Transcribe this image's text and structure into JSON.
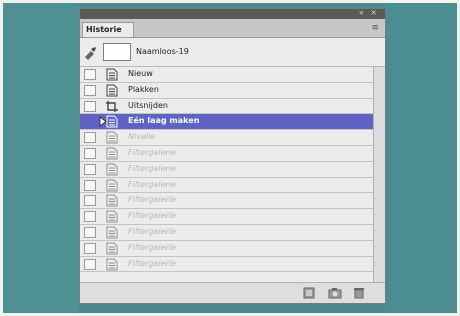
{
  "panel": {
    "tab_label": "Historie",
    "window_controls": "« ×",
    "menu_glyph": "≡"
  },
  "snapshot": {
    "name": "Naamloos-19"
  },
  "history": {
    "items": [
      {
        "label": "Nieuw",
        "icon": "document-icon",
        "state": "normal"
      },
      {
        "label": "Plakken",
        "icon": "document-icon",
        "state": "normal"
      },
      {
        "label": "Uitsnijden",
        "icon": "crop-icon",
        "state": "normal"
      },
      {
        "label": "Eén laag maken",
        "icon": "document-icon",
        "state": "active"
      },
      {
        "label": "Nivelle",
        "icon": "document-icon",
        "state": "dim"
      },
      {
        "label": "Filtergalerie",
        "icon": "document-icon",
        "state": "dim"
      },
      {
        "label": "Filtergalerie",
        "icon": "document-icon",
        "state": "dim"
      },
      {
        "label": "Filtergalerie",
        "icon": "document-icon",
        "state": "dim"
      },
      {
        "label": "Filtergalerie",
        "icon": "document-icon",
        "state": "dim"
      },
      {
        "label": "Filtergalerie",
        "icon": "document-icon",
        "state": "dim"
      },
      {
        "label": "Filtergalerie",
        "icon": "document-icon",
        "state": "dim"
      },
      {
        "label": "Filtergalerie",
        "icon": "document-icon",
        "state": "dim"
      },
      {
        "label": "Filtergalerie",
        "icon": "document-icon",
        "state": "dim"
      }
    ]
  },
  "bottom_buttons": [
    {
      "name": "new-document-from-state-icon"
    },
    {
      "name": "new-snapshot-icon"
    },
    {
      "name": "delete-state-icon"
    }
  ],
  "colors": {
    "active_row": "#5f63c4",
    "background_teal": "#4a8a8e"
  }
}
